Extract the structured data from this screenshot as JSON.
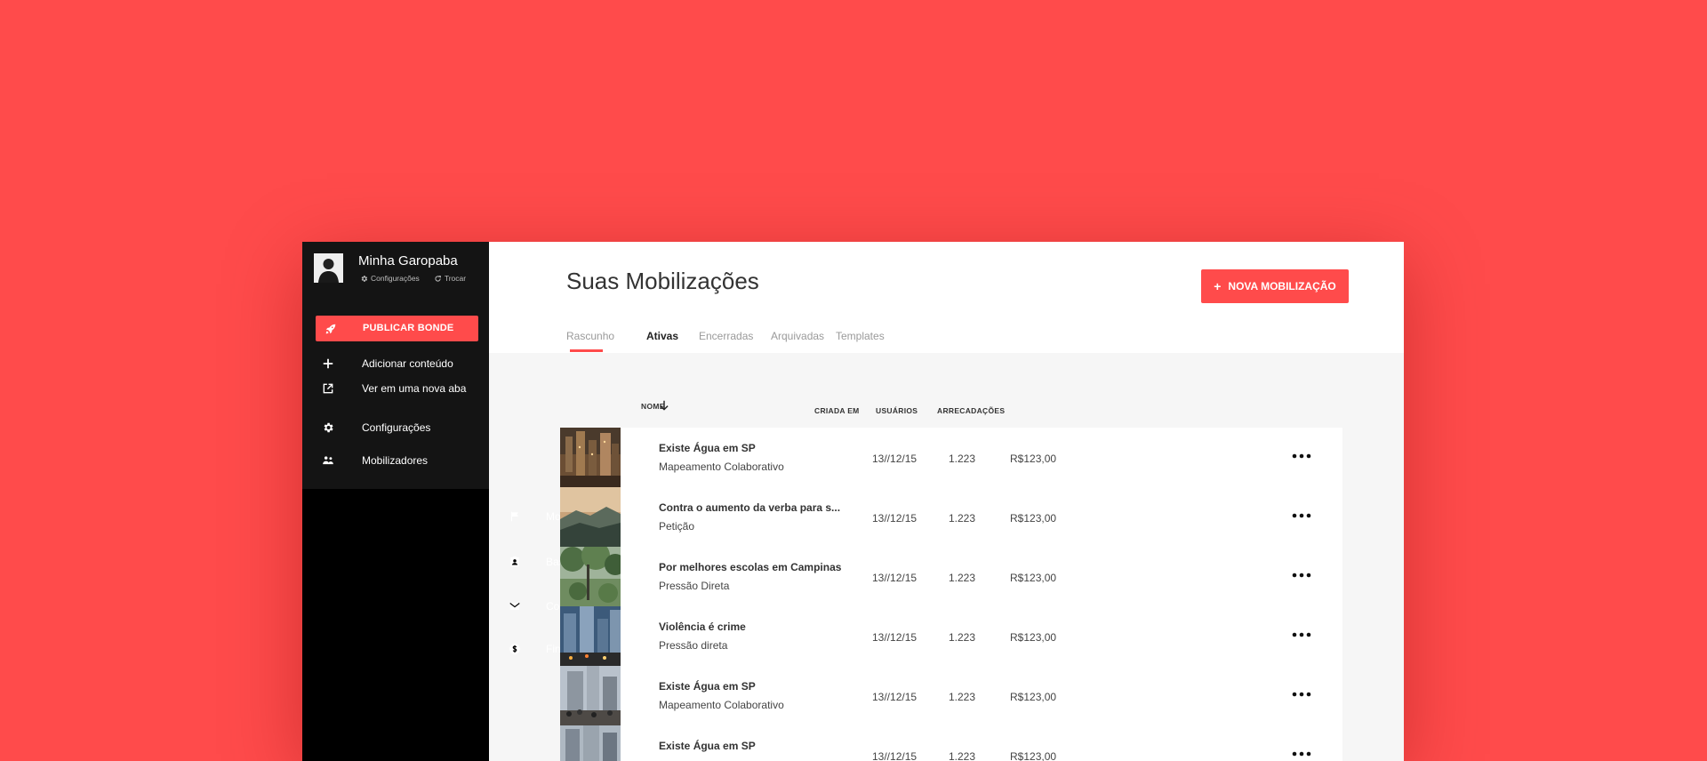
{
  "sidebar": {
    "community_name": "Minha Garopaba",
    "settings_link": "Configurações",
    "switch_link": "Trocar",
    "publish_button": "PUBLICAR BONDE",
    "top_items": [
      {
        "label": "Adicionar conteúdo",
        "icon": "plus-icon"
      },
      {
        "label": "Ver em uma nova aba",
        "icon": "external-link-icon"
      },
      {
        "label": "Configurações",
        "icon": "gear-icon"
      },
      {
        "label": "Mobilizadores",
        "icon": "people-icon"
      }
    ],
    "main_items": [
      {
        "label": "Mobilizações",
        "icon": "flag-icon"
      },
      {
        "label": "Base de usuários",
        "icon": "contact-icon"
      },
      {
        "label": "Comunicação",
        "icon": "mail-icon"
      },
      {
        "label": "Financiamento",
        "icon": "dollar-icon"
      }
    ]
  },
  "main": {
    "title": "Suas Mobilizações",
    "new_button": "NOVA MOBILIZAÇÃO",
    "new_button_icon": "+",
    "tabs": [
      "Rascunho",
      "Ativas",
      "Encerradas",
      "Arquivadas",
      "Templates"
    ],
    "active_tab": "Ativas"
  },
  "table": {
    "columns": {
      "name": "NOME",
      "created": "CRIADA EM",
      "users": "USUÁRIOS",
      "raised": "ARRECADAÇÕES"
    },
    "rows": [
      {
        "title": "Existe Água em SP",
        "subtitle": "Mapeamento Colaborativo",
        "created": "13//12/15",
        "users": "1.223",
        "raised": "R$123,00"
      },
      {
        "title": "Contra o aumento da verba para s...",
        "subtitle": "Petição",
        "created": "13//12/15",
        "users": "1.223",
        "raised": "R$123,00"
      },
      {
        "title": "Por melhores escolas em Campinas",
        "subtitle": "Pressão Direta",
        "created": "13//12/15",
        "users": "1.223",
        "raised": "R$123,00"
      },
      {
        "title": "Violência é crime",
        "subtitle": "Pressão direta",
        "created": "13//12/15",
        "users": "1.223",
        "raised": "R$123,00"
      },
      {
        "title": "Existe Água em SP",
        "subtitle": "Mapeamento Colaborativo",
        "created": "13//12/15",
        "users": "1.223",
        "raised": "R$123,00"
      },
      {
        "title": "Existe Água em SP",
        "subtitle": "",
        "created": "13//12/15",
        "users": "1.223",
        "raised": "R$123,00"
      }
    ]
  },
  "colors": {
    "accent": "#ff4b4b",
    "sidebar": "#000000",
    "sidebar_top": "#141414"
  }
}
